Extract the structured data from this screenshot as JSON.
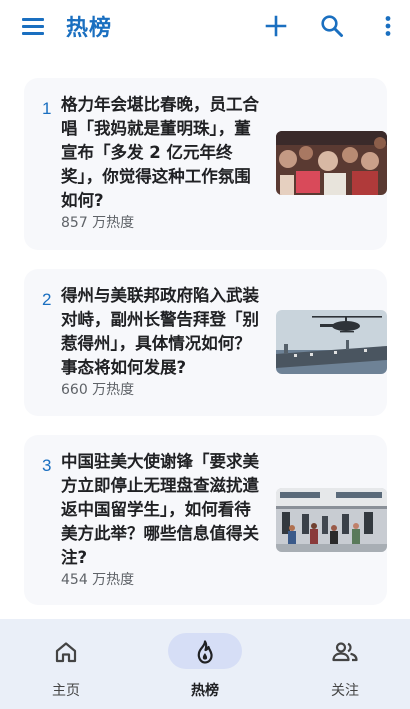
{
  "header": {
    "title": "热榜",
    "icons": [
      "menu-icon",
      "add-icon",
      "search-icon",
      "more-vert-icon"
    ]
  },
  "items": [
    {
      "rank": "1",
      "title": "格力年会堪比春晚，员工合唱「我妈就是董明珠」，董宣布「多发 2 亿元年终奖」，你觉得这种工作氛围如何?",
      "heat": "857 万热度"
    },
    {
      "rank": "2",
      "title": "得州与美联邦政府陷入武装对峙，副州长警告拜登「别惹得州」，具体情况如何？事态将如何发展?",
      "heat": "660 万热度"
    },
    {
      "rank": "3",
      "title": "中国驻美大使谢锋「要求美方立即停止无理盘查滋扰遣返中国留学生」，如何看待美方此举？哪些信息值得关注?",
      "heat": "454 万热度"
    }
  ],
  "nav": {
    "home": "主页",
    "hot": "热榜",
    "follow": "关注",
    "active": "hot"
  },
  "colors": {
    "accent": "#1a6fc0",
    "card_bg": "#f7f8fb",
    "nav_bg": "#eaeff8",
    "nav_pill": "#d6def6"
  }
}
